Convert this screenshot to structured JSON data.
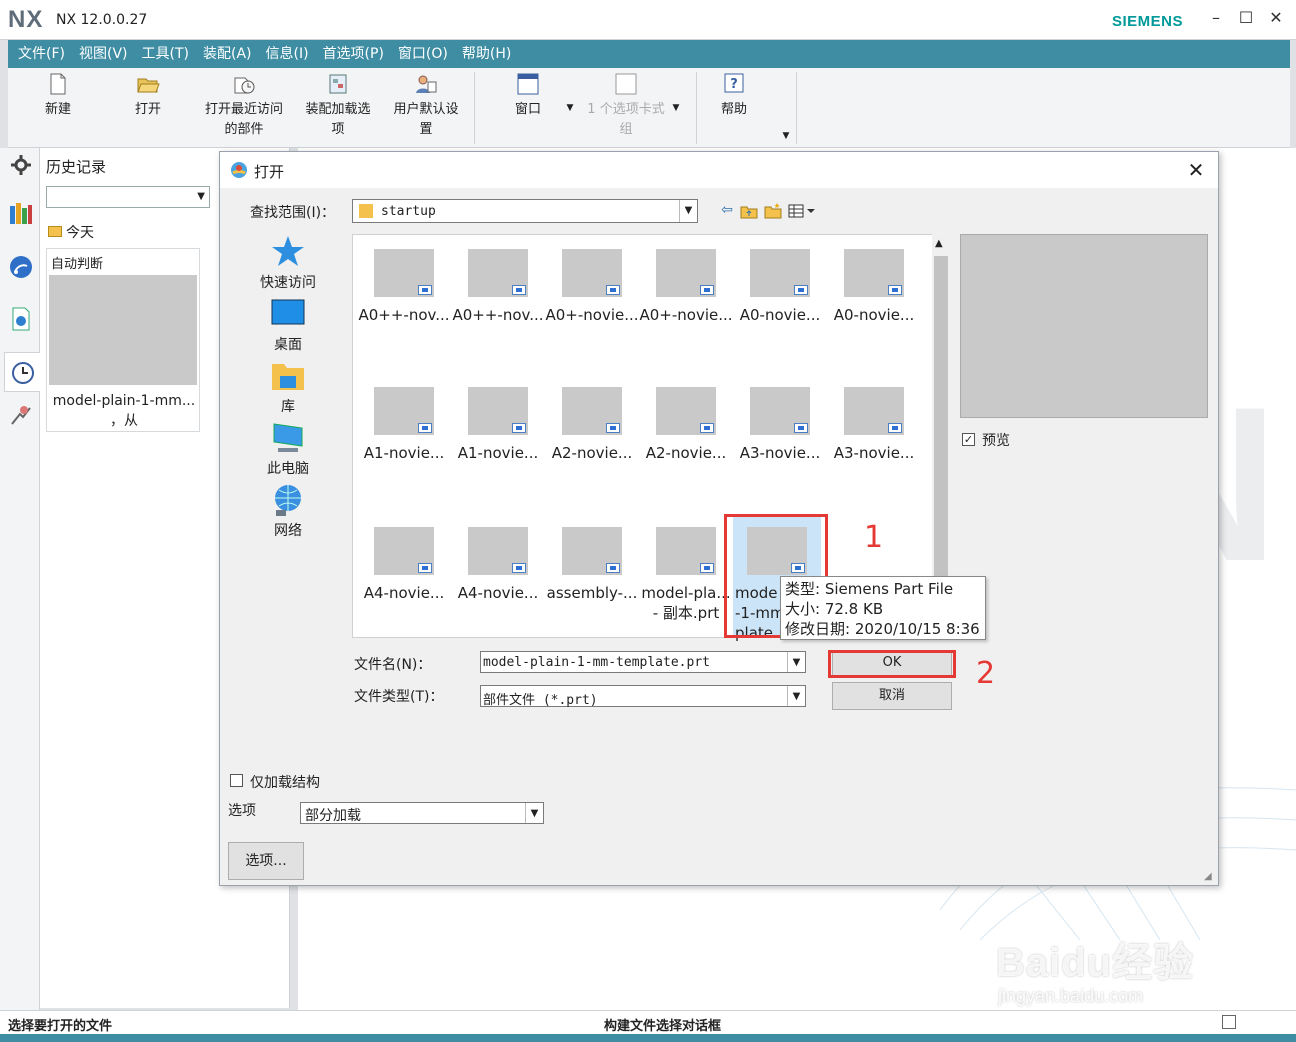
{
  "app": {
    "logo": "NX",
    "version": "NX 12.0.0.27",
    "brand": "SIEMENS",
    "win_controls": {
      "minimize": "–",
      "maximize": "☐",
      "close": "✕"
    }
  },
  "menu": [
    "文件(F)",
    "视图(V)",
    "工具(T)",
    "装配(A)",
    "信息(I)",
    "首选项(P)",
    "窗口(O)",
    "帮助(H)"
  ],
  "ribbon": {
    "new": "新建",
    "open": "打开",
    "recent_1": "打开最近访问",
    "recent_2": "的部件",
    "asm_1": "装配加载选",
    "asm_2": "项",
    "userdef_1": "用户默认设",
    "userdef_2": "置",
    "window": "窗口",
    "tabgroup_1": "1 个选项卡式",
    "tabgroup_2": "组",
    "help": "帮助"
  },
  "history": {
    "title": "历史记录",
    "group": "今天",
    "card_label": "自动判断",
    "file_line1": "model-plain-1-mm...",
    "file_line2": "，从"
  },
  "dialog": {
    "title": "打开",
    "lookin_label": "查找范围(I)：",
    "lookin_value": "startup",
    "places": [
      "快速访问",
      "桌面",
      "库",
      "此电脑",
      "网络"
    ],
    "files": [
      {
        "name": "A0++-nov..."
      },
      {
        "name": "A0++-nov..."
      },
      {
        "name": "A0+-novie..."
      },
      {
        "name": "A0+-novie..."
      },
      {
        "name": "A0-novie..."
      },
      {
        "name": "A0-novie..."
      },
      {
        "name": "A1-novie..."
      },
      {
        "name": "A1-novie..."
      },
      {
        "name": "A2-novie..."
      },
      {
        "name": "A2-novie..."
      },
      {
        "name": "A3-novie..."
      },
      {
        "name": "A3-novie..."
      },
      {
        "name": "A4-novie..."
      },
      {
        "name": "A4-novie..."
      },
      {
        "name": "assembly-..."
      },
      {
        "name": "model-pla...",
        "name2": "- 副本.prt"
      },
      {
        "name": "mode",
        "name2": "-1-mm",
        "name3": "plate",
        "selected": true
      }
    ],
    "tooltip": {
      "type": "类型: Siemens Part File",
      "size": "大小: 72.8 KB",
      "date": "修改日期: 2020/10/15 8:36"
    },
    "preview_label": "预览",
    "preview_checked": true,
    "filename_label": "文件名(N)：",
    "filename_value": "model-plain-1-mm-template.prt",
    "filetype_label": "文件类型(T)：",
    "filetype_value": "部件文件 (*.prt)",
    "ok": "OK",
    "cancel": "取消",
    "load_structure": "仅加载结构",
    "options_label": "选项",
    "options_value": "部分加载",
    "options_button": "选项..."
  },
  "annotations": {
    "one": "1",
    "two": "2",
    "color": "#e53935"
  },
  "status": {
    "left": "选择要打开的文件",
    "middle": "构建文件选择对话框"
  },
  "watermark": {
    "line1": "Baidu经验",
    "line2": "jingyan.baidu.com"
  },
  "colors": {
    "accent": "#3e8da3",
    "brand": "#009999",
    "selection": "#cce4f7"
  }
}
